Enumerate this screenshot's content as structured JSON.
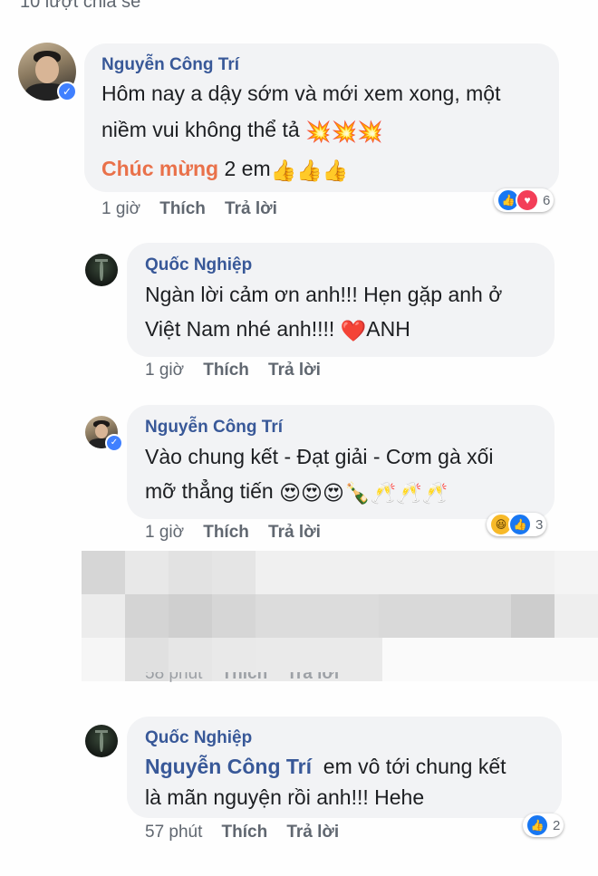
{
  "shares_label": "10 lượt chia sẻ",
  "comments": [
    {
      "author": "Nguyễn Công Trí",
      "line1": "Hôm nay a dậy sớm và mới xem xong, một",
      "line2_text": "niềm vui không thể tả",
      "line2_emoji": "💥💥💥",
      "line3_highlight": "Chúc mừng",
      "line3_text": " 2 em",
      "line3_emoji": "👍👍👍",
      "time": "1 giờ",
      "like": "Thích",
      "reply": "Trả lời",
      "reaction_count": "6"
    },
    {
      "author": "Quốc Nghiệp",
      "line1": "Ngàn lời cảm ơn anh!!! Hẹn gặp anh ở",
      "line2_text": "Việt Nam nhé anh!!!! ",
      "line2_emoji": "❤️",
      "line2_tail": "ANH",
      "time": "1 giờ",
      "like": "Thích",
      "reply": "Trả lời"
    },
    {
      "author": "Nguyễn Công Trí",
      "line1": "Vào chung kết - Đạt giải - Cơm gà xối",
      "line2_text": "mỡ thẳng tiến ",
      "line2_emoji": "😍😍😍🍾🥂🥂🥂",
      "time": "1 giờ",
      "like": "Thích",
      "reply": "Trả lời",
      "reaction_count": "3"
    },
    {
      "time": "58 phút",
      "like": "Thích",
      "reply": "Trả lời"
    },
    {
      "author": "Quốc Nghiệp",
      "tag": "Nguyễn Công Trí",
      "line1": "  em vô tới chung kết",
      "line2_text": "là mãn nguyện rồi anh!!! Hehe",
      "time": "57 phút",
      "like": "Thích",
      "reply": "Trả lời",
      "reaction_count": "2"
    }
  ]
}
